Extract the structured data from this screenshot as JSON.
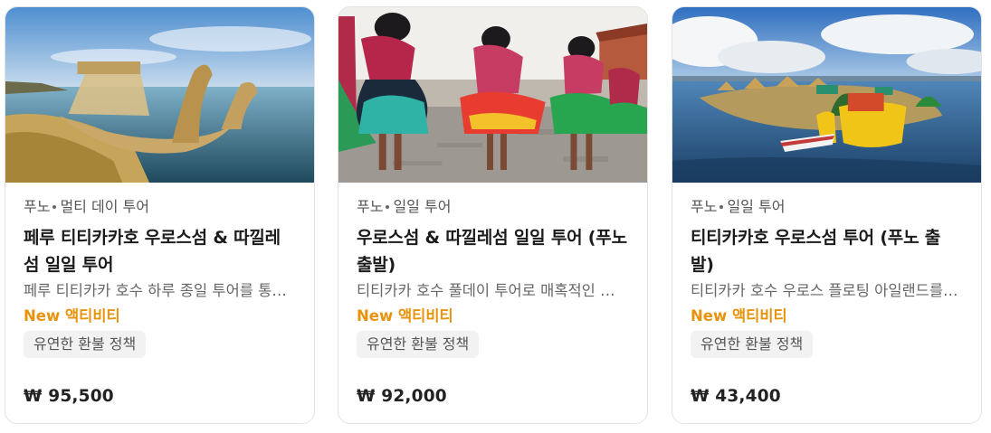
{
  "cards": [
    {
      "location": "푸노",
      "tour_type": "멀티 데이 투어",
      "title": "페루 티티카카호 우로스섬 & 따낄레섬 일일 투어",
      "description": "페루 티티카카 호수 하루 종일 투어를 통해 우로스섬과 따낄레섬을 방문하세요",
      "new_label": "New 액티비티",
      "badge": "유연한 환불 정책",
      "price": "₩ 95,500",
      "image": "reed-boat-lake-titicaca"
    },
    {
      "location": "푸노",
      "tour_type": "일일 투어",
      "title": "우로스섬 & 따낄레섬 일일 투어 (푸노 출발)",
      "description": "티티카카 호수 풀데이 투어로 매혹적인 섬들을 방문하세요",
      "new_label": "New 액티비티",
      "badge": "유연한 환불 정책",
      "price": "₩ 92,000",
      "image": "traditional-dancers"
    },
    {
      "location": "푸노",
      "tour_type": "일일 투어",
      "title": "티티카카호 우로스섬 투어 (푸노 출발)",
      "description": "티티카카 호수 우로스 플로팅 아일랜드를 방문하세요",
      "new_label": "New 액티비티",
      "badge": "유연한 환불 정책",
      "price": "₩ 43,400",
      "image": "uros-floating-islands"
    }
  ],
  "colors": {
    "new_label": "#e8930c",
    "badge_bg": "#f2f2f2",
    "border": "#e3e3e3"
  }
}
